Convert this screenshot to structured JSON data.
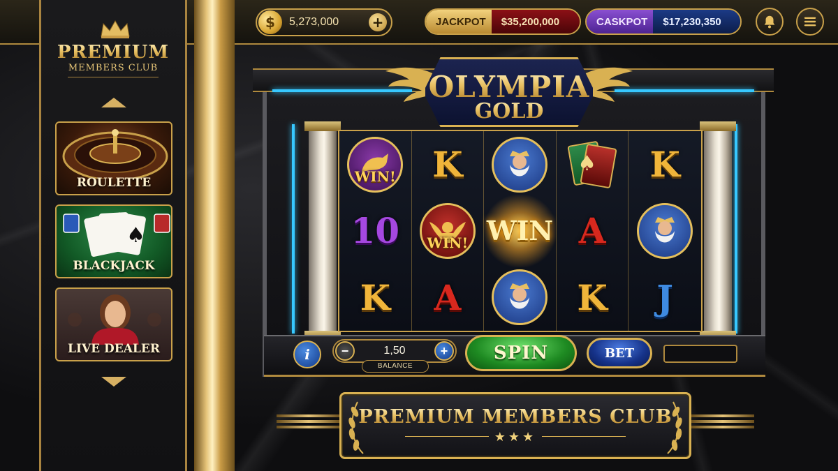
{
  "topbar": {
    "coins": "5,273,000",
    "coin_symbol": "$",
    "add_coins": "+",
    "jackpot_label": "JACKPOT",
    "jackpot_value": "$35,200,000",
    "caskpot_label": "CASKPOT",
    "caskpot_value": "$17,230,350",
    "bell_icon": "bell-icon",
    "menu_icon": "hamburger-menu-icon"
  },
  "sidebar": {
    "title": "PREMIUM",
    "subtitle": "MEMBERS CLUB",
    "games": [
      {
        "label": "ROULETTE"
      },
      {
        "label": "BLACKJACK"
      },
      {
        "label": "LIVE DEALER"
      }
    ]
  },
  "slot": {
    "title": "OLYMPIA",
    "subtitle": "GOLD",
    "reels": [
      [
        "pegasus-medal",
        "K",
        "zeus-medal",
        "cards-symbol",
        "K"
      ],
      [
        "10",
        "angel-medal",
        "win-burst",
        "A",
        "zeus-medal"
      ],
      [
        "K",
        "A",
        "zeus-medal",
        "K",
        "J"
      ]
    ],
    "win_tag": "WIN!",
    "win_big": "WIN",
    "spade": "♠"
  },
  "controls": {
    "info": "i",
    "minus": "−",
    "plus": "+",
    "bet_value": "1,50",
    "balance_label": "BALANCE",
    "spin": "SPIN",
    "bet": "BET"
  },
  "banner": {
    "title": "PREMIUM MEMBERS CLUB",
    "stars": "★★★"
  },
  "colors": {
    "gold": "#d9b152",
    "neon": "#37c8ff",
    "jackpot": "#8c1016",
    "caskpot_label": "#8a4fd1",
    "caskpot_value": "#1c3a86",
    "spin_green": "#1e8a22",
    "bet_blue": "#16338a"
  }
}
